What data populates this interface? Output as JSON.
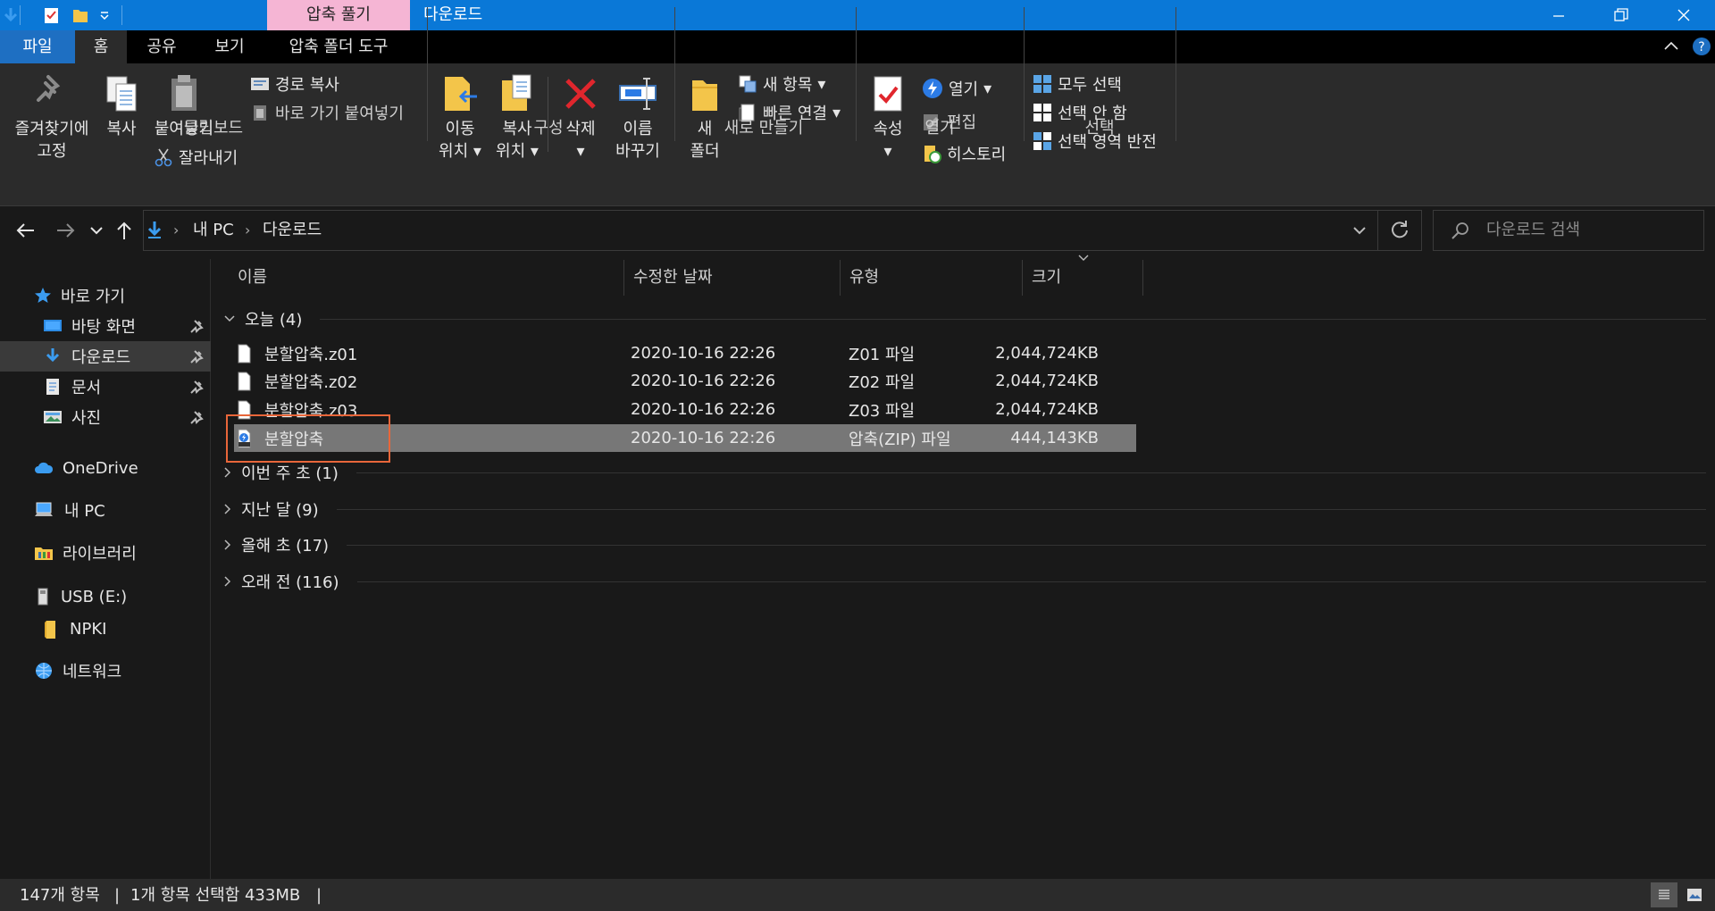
{
  "titlebar": {
    "context_tab": "압축 풀기",
    "title": "다운로드"
  },
  "tabs": [
    "파일",
    "홈",
    "공유",
    "보기",
    "압축 폴더 도구"
  ],
  "ribbon": {
    "clipboard": {
      "pin_line1": "즐겨찾기에",
      "pin_line2": "고정",
      "copy": "복사",
      "paste": "붙여넣기",
      "copy_path": "경로 복사",
      "paste_shortcut": "바로 가기 붙여넣기",
      "cut": "잘라내기",
      "group": "클립보드"
    },
    "organize": {
      "move_line1": "이동",
      "move_line2": "위치",
      "copyto_line1": "복사",
      "copyto_line2": "위치",
      "delete": "삭제",
      "rename_line1": "이름",
      "rename_line2": "바꾸기",
      "group": "구성"
    },
    "new": {
      "folder_line1": "새",
      "folder_line2": "폴더",
      "new_item": "새 항목",
      "easy_access": "빠른 연결",
      "group": "새로 만들기"
    },
    "open": {
      "properties": "속성",
      "open": "열기",
      "edit": "편집",
      "history": "히스토리",
      "group": "열기"
    },
    "select": {
      "select_all": "모두 선택",
      "select_none": "선택 안 함",
      "invert": "선택 영역 반전",
      "group": "선택"
    }
  },
  "address": {
    "crumbs": [
      "내 PC",
      "다운로드"
    ],
    "search_placeholder": "다운로드 검색"
  },
  "nav": {
    "quick_access": "바로 가기",
    "items": [
      "바탕 화면",
      "다운로드",
      "문서",
      "사진"
    ],
    "onedrive": "OneDrive",
    "thispc": "내 PC",
    "libraries": "라이브러리",
    "usb": "USB (E:)",
    "npki": "NPKI",
    "network": "네트워크"
  },
  "columns": {
    "name": "이름",
    "modified": "수정한 날짜",
    "type": "유형",
    "size": "크기"
  },
  "groups": {
    "today": "오늘 (4)",
    "this_week": "이번 주 초 (1)",
    "last_month": "지난 달 (9)",
    "this_year": "올해 초 (17)",
    "long_ago": "오래 전 (116)"
  },
  "files": [
    {
      "name": "분할압축.z01",
      "date": "2020-10-16 22:26",
      "type": "Z01 파일",
      "size": "2,044,724KB"
    },
    {
      "name": "분할압축.z02",
      "date": "2020-10-16 22:26",
      "type": "Z02 파일",
      "size": "2,044,724KB"
    },
    {
      "name": "분할압축.z03",
      "date": "2020-10-16 22:26",
      "type": "Z03 파일",
      "size": "2,044,724KB"
    },
    {
      "name": "분할압축",
      "date": "2020-10-16 22:26",
      "type": "압축(ZIP) 파일",
      "size": "444,143KB"
    }
  ],
  "status": {
    "count": "147개 항목",
    "selected": "1개 항목 선택함 433MB"
  },
  "colors": {
    "accent": "#0a78d7",
    "context_tab": "#f5b5d4",
    "selection": "#777777",
    "highlight_box": "#e8663a"
  }
}
